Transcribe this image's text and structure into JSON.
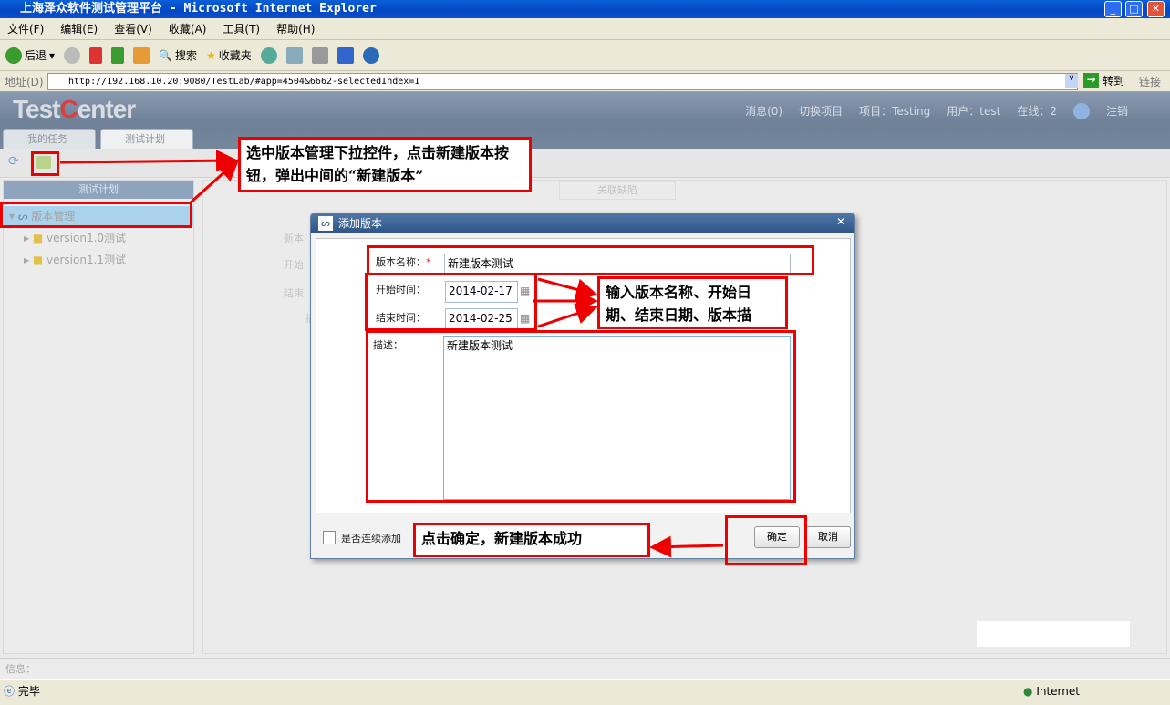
{
  "window": {
    "title": "上海泽众软件测试管理平台 - Microsoft Internet Explorer",
    "min": "_",
    "max": "□",
    "close": "✕"
  },
  "menu": [
    "文件(F)",
    "编辑(E)",
    "查看(V)",
    "收藏(A)",
    "工具(T)",
    "帮助(H)"
  ],
  "toolbar": {
    "back": "后退",
    "search": "搜索",
    "favorites": "收藏夹"
  },
  "address": {
    "label": "地址(D)",
    "url": "http://192.168.10.20:9080/TestLab/#app=4504&6662-selectedIndex=1",
    "go": "转到",
    "links": "链接"
  },
  "app": {
    "logo_a": "Test",
    "logo_b": "C",
    "logo_c": "enter",
    "header": {
      "messages": "消息(0)",
      "switch_project": "切换项目",
      "project": "项目：Testing",
      "user": "用户：test",
      "online": "在线：2",
      "logout": "注销"
    },
    "tabs": [
      "我的任务",
      "测试计划"
    ],
    "left_panel": {
      "title": "测试计划",
      "root": "版本管理",
      "children": [
        "version1.0测试",
        "version1.1测试"
      ]
    },
    "content": {
      "tab": "关联缺陷",
      "labels": [
        "新本",
        "开始",
        "结束",
        "描"
      ]
    },
    "info_label": "信息："
  },
  "dialog": {
    "title": "添加版本",
    "name_label": "版本名称：",
    "required": "*",
    "name_value": "新建版本测试",
    "start_label": "开始时间：",
    "start_value": "2014-02-17",
    "end_label": "结束时间：",
    "end_value": "2014-02-25",
    "desc_label": "描述：",
    "desc_value": "新建版本测试",
    "continue_label": "是否连续添加",
    "ok": "确定",
    "cancel": "取消"
  },
  "annotations": {
    "a1": "选中版本管理下拉控件，点击新建版本按钮，弹出中间的“新建版本”",
    "a2": "输入版本名称、开始日期、结束日期、版本描",
    "a3": "点击确定，新建版本成功"
  },
  "status": {
    "text": "完毕",
    "zone": "Internet"
  }
}
